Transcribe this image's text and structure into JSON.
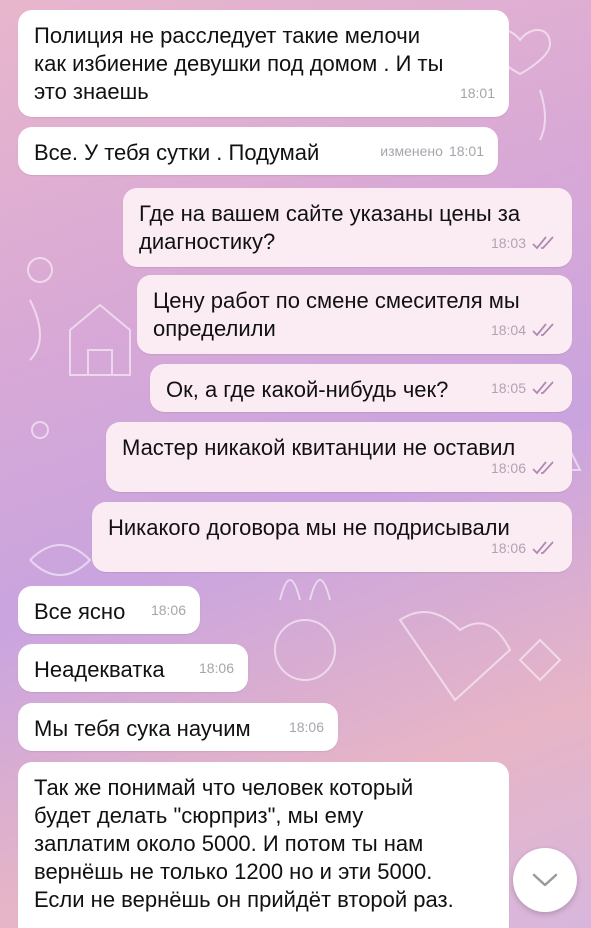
{
  "colors": {
    "incoming_bg": "#ffffff",
    "outgoing_bg": "#fbecf4",
    "check_color": "#b08ab0",
    "wallpaper_start": "#e8b6cc",
    "wallpaper_end": "#c9a4df"
  },
  "messages": [
    {
      "direction": "in",
      "text": "Полиция не расследует такие мелочи\nкак избиение девушки под домом . И ты\nэто знаешь",
      "edited": "",
      "time": "18:01"
    },
    {
      "direction": "in",
      "text": "Все. У тебя сутки . Подумай",
      "edited": "изменено",
      "time": "18:01"
    },
    {
      "direction": "out",
      "text": "Где на вашем сайте указаны цены за\nдиагностику?",
      "time": "18:03",
      "status_icon": "double-check-icon"
    },
    {
      "direction": "out",
      "text": "Цену работ по смене смесителя мы\nопределили",
      "time": "18:04",
      "status_icon": "double-check-icon"
    },
    {
      "direction": "out",
      "text": "Ок, а где какой-нибудь чек?",
      "time": "18:05",
      "status_icon": "double-check-icon"
    },
    {
      "direction": "out",
      "text": "Мастер никакой квитанции не оставил",
      "time": "18:06",
      "status_icon": "double-check-icon"
    },
    {
      "direction": "out",
      "text": "Никакого договора мы не подрисывали",
      "time": "18:06",
      "status_icon": "double-check-icon"
    },
    {
      "direction": "in",
      "text": "Все ясно",
      "edited": "",
      "time": "18:06"
    },
    {
      "direction": "in",
      "text": "Неадекватка",
      "edited": "",
      "time": "18:06"
    },
    {
      "direction": "in",
      "text": "Мы тебя сука научим",
      "edited": "",
      "time": "18:06"
    },
    {
      "direction": "in",
      "text": "Так же понимай что человек который\nбудет делать \"сюрприз\", мы ему\nзаплатим около 5000. И потом ты нам\nвернёшь не только 1200 но и эти 5000.\nЕсли не вернёшь он прийдёт второй раз.",
      "edited": "",
      "time": ""
    }
  ],
  "scroll_button": {
    "icon": "chevron-down-icon"
  }
}
